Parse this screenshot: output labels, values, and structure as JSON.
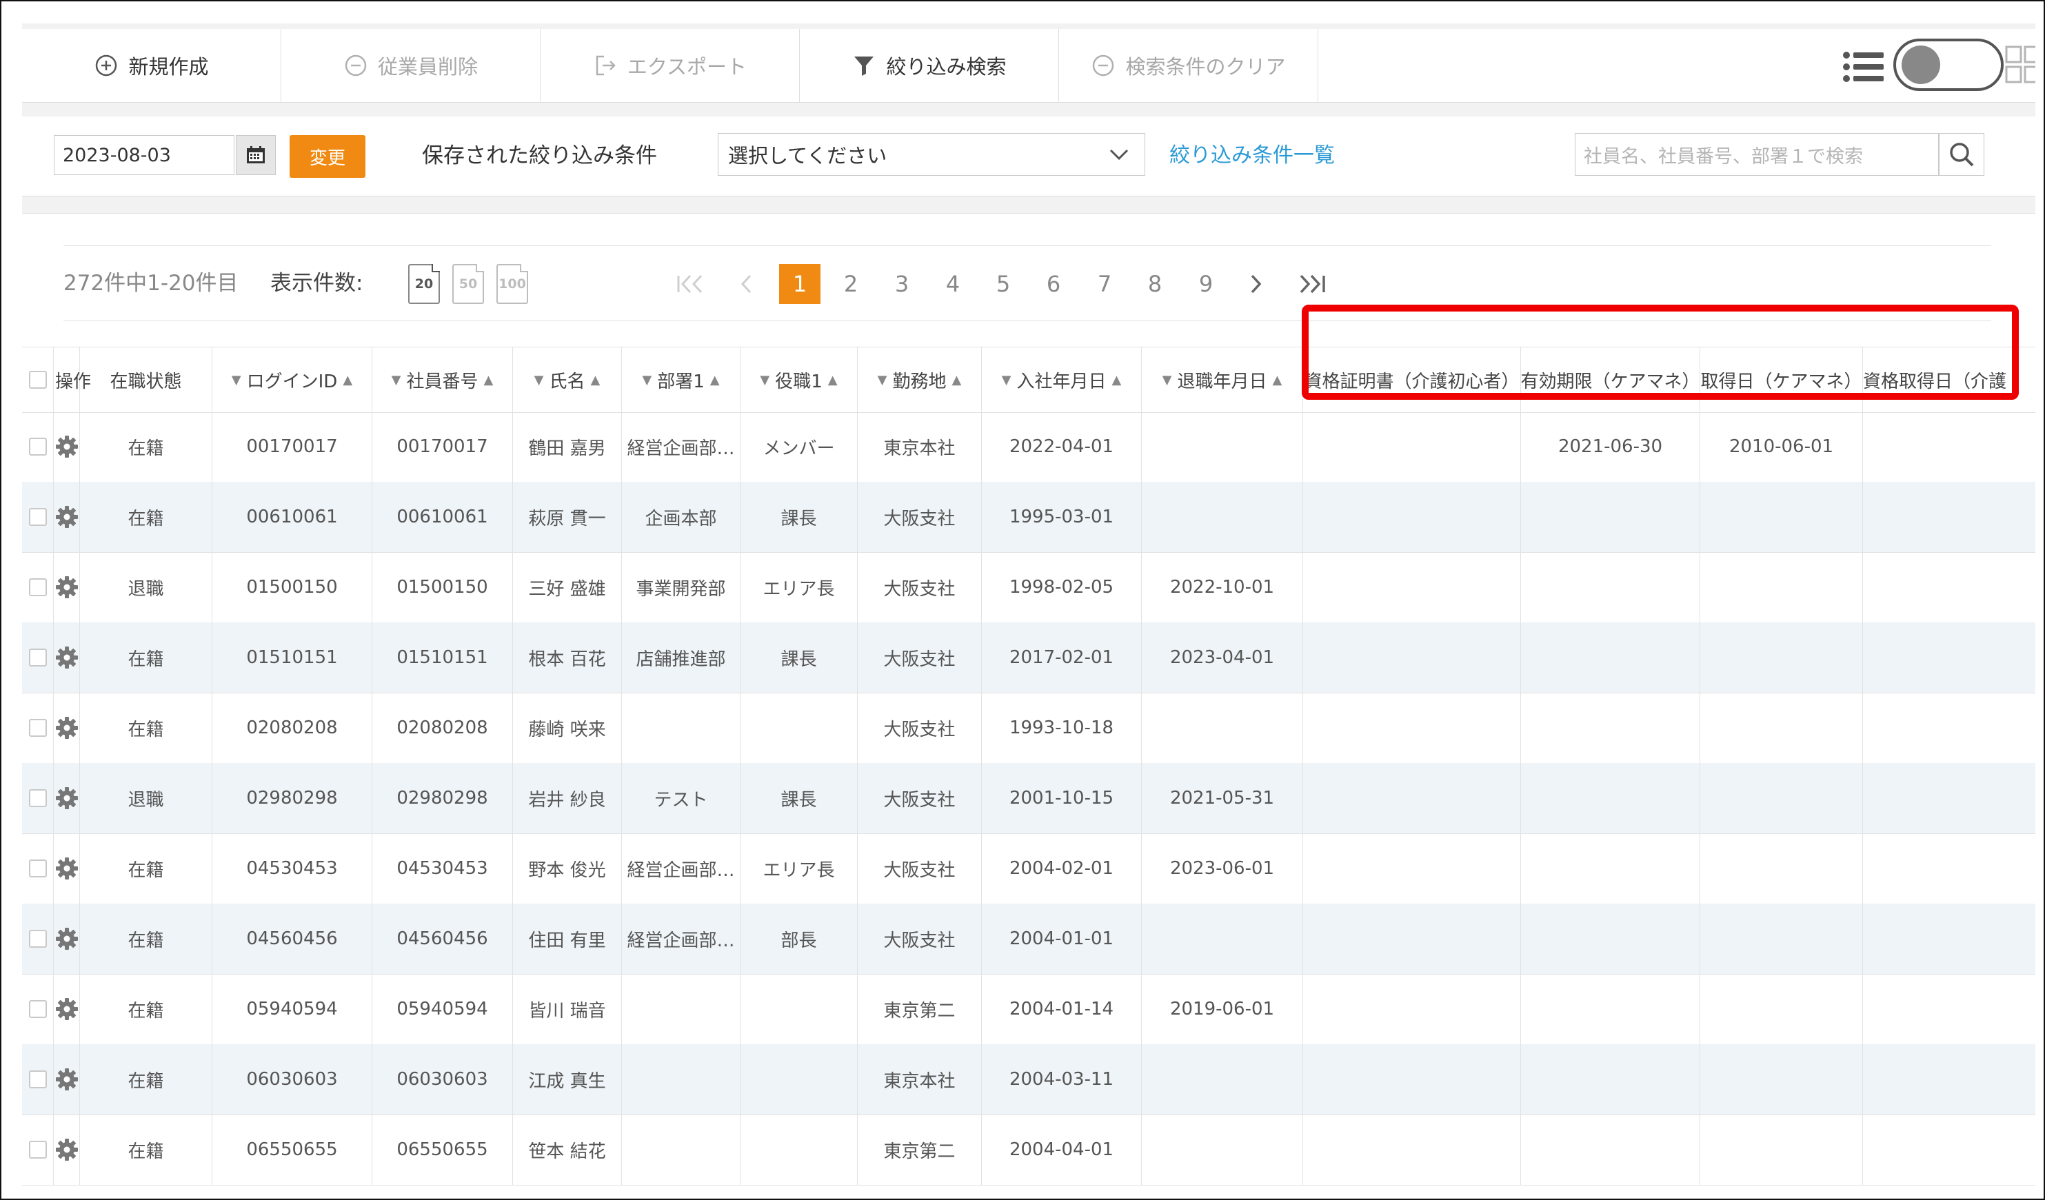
{
  "toolbar": {
    "new_label": "新規作成",
    "delete_label": "従業員削除",
    "export_label": "エクスポート",
    "filter_label": "絞り込み検索",
    "clear_label": "検索条件のクリア"
  },
  "filterbar": {
    "date_value": "2023-08-03",
    "change_label": "変更",
    "saved_filters_label": "保存された絞り込み条件",
    "select_value": "選択してください",
    "filter_list_link": "絞り込み条件一覧",
    "search_placeholder": "社員名、社員番号、部署１で検索"
  },
  "pager": {
    "count_text": "272件中1-20件目",
    "per_page_label": "表示件数:",
    "per_page_options": [
      "20",
      "50",
      "100"
    ],
    "pages": [
      "1",
      "2",
      "3",
      "4",
      "5",
      "6",
      "7",
      "8",
      "9"
    ],
    "current_page": "1"
  },
  "table": {
    "columns": [
      "操作",
      "在職状態",
      "ログインID",
      "社員番号",
      "氏名",
      "部署1",
      "役職1",
      "勤務地",
      "入社年月日",
      "退職年月日",
      "資格証明書（介護初心者）",
      "有効期限（ケアマネ）",
      "取得日（ケアマネ）",
      "資格取得日（介護"
    ],
    "rows": [
      [
        "在籍",
        "00170017",
        "00170017",
        "鶴田 嘉男",
        "経営企画部…",
        "メンバー",
        "東京本社",
        "2022-04-01",
        "",
        "",
        "2021-06-30",
        "2010-06-01",
        ""
      ],
      [
        "在籍",
        "00610061",
        "00610061",
        "萩原 貫一",
        "企画本部",
        "課長",
        "大阪支社",
        "1995-03-01",
        "",
        "",
        "",
        "",
        ""
      ],
      [
        "退職",
        "01500150",
        "01500150",
        "三好 盛雄",
        "事業開発部",
        "エリア長",
        "大阪支社",
        "1998-02-05",
        "2022-10-01",
        "",
        "",
        "",
        ""
      ],
      [
        "在籍",
        "01510151",
        "01510151",
        "根本 百花",
        "店舗推進部",
        "課長",
        "大阪支社",
        "2017-02-01",
        "2023-04-01",
        "",
        "",
        "",
        ""
      ],
      [
        "在籍",
        "02080208",
        "02080208",
        "藤崎 咲来",
        "",
        "",
        "大阪支社",
        "1993-10-18",
        "",
        "",
        "",
        "",
        ""
      ],
      [
        "退職",
        "02980298",
        "02980298",
        "岩井 紗良",
        "テスト",
        "課長",
        "大阪支社",
        "2001-10-15",
        "2021-05-31",
        "",
        "",
        "",
        ""
      ],
      [
        "在籍",
        "04530453",
        "04530453",
        "野本 俊光",
        "経営企画部…",
        "エリア長",
        "大阪支社",
        "2004-02-01",
        "2023-06-01",
        "",
        "",
        "",
        ""
      ],
      [
        "在籍",
        "04560456",
        "04560456",
        "住田 有里",
        "経営企画部…",
        "部長",
        "大阪支社",
        "2004-01-01",
        "",
        "",
        "",
        "",
        ""
      ],
      [
        "在籍",
        "05940594",
        "05940594",
        "皆川 瑞音",
        "",
        "",
        "東京第二",
        "2004-01-14",
        "2019-06-01",
        "",
        "",
        "",
        ""
      ],
      [
        "在籍",
        "06030603",
        "06030603",
        "江成 真生",
        "",
        "",
        "東京本社",
        "2004-03-11",
        "",
        "",
        "",
        "",
        ""
      ],
      [
        "在籍",
        "06550655",
        "06550655",
        "笹本 結花",
        "",
        "",
        "東京第二",
        "2004-04-01",
        "",
        "",
        "",
        "",
        ""
      ]
    ]
  },
  "colors": {
    "accent": "#f08a12",
    "link": "#2a9ad6",
    "highlight": "#ee0000",
    "row_alt": "#eef4f8"
  }
}
